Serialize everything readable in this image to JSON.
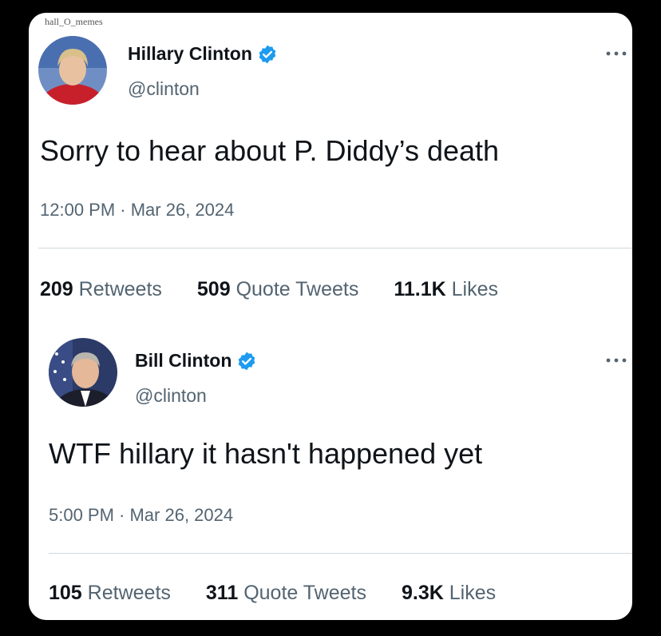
{
  "watermark": "hall_O_memes",
  "colors": {
    "background": "#000000",
    "card": "#ffffff",
    "verified": "#1d9bf0",
    "text_primary": "#0f1419",
    "text_secondary": "#536471"
  },
  "icons": {
    "verified": "verified-badge-icon",
    "more": "more-options-icon"
  },
  "tweets": [
    {
      "author_name": "Hillary Clinton",
      "handle": "@clinton",
      "verified": true,
      "text": "Sorry to hear about P. Diddy’s death",
      "timestamp": "12:00 PM · Mar 26, 2024",
      "retweets": "209",
      "retweets_label": "Retweets",
      "quotes": "509",
      "quotes_label": "Quote Tweets",
      "likes": "11.1K",
      "likes_label": "Likes"
    },
    {
      "author_name": "Bill Clinton",
      "handle": "@clinton",
      "verified": true,
      "text": "WTF hillary it hasn't happened yet",
      "timestamp": "5:00 PM · Mar 26, 2024",
      "retweets": "105",
      "retweets_label": "Retweets",
      "quotes": "311",
      "quotes_label": "Quote Tweets",
      "likes": "9.3K",
      "likes_label": "Likes"
    }
  ]
}
